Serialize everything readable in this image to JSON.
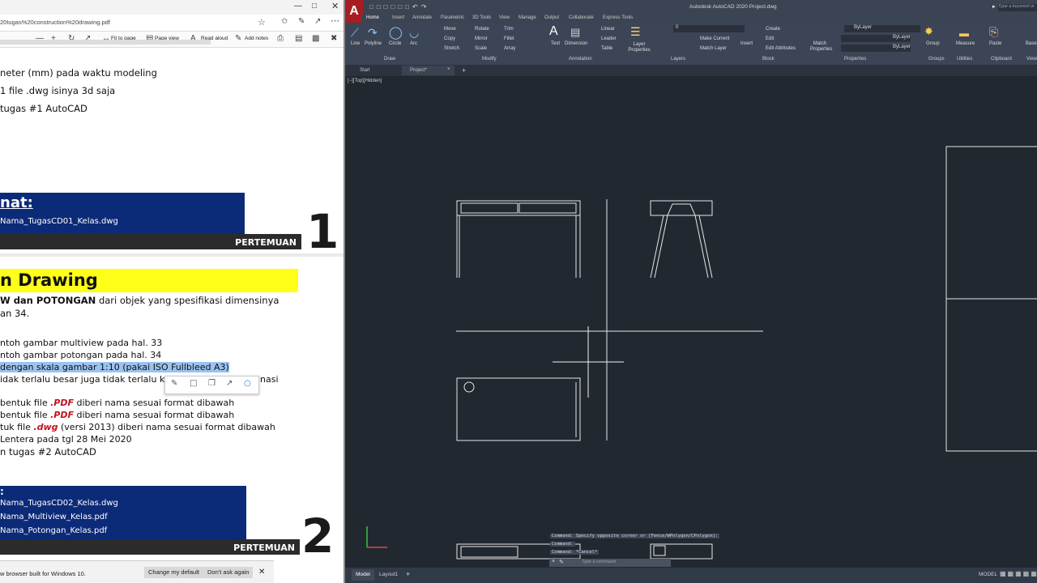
{
  "browser": {
    "url": "20tugas%20construction%20drawing.pdf",
    "toolbar": {
      "fit_to_page": "Fit to page",
      "page_view": "Page view",
      "read_aloud": "Read aloud",
      "add_notes": "Add notes"
    },
    "pdf": {
      "lines_top": [
        "neter (mm) pada waktu modeling",
        "1 file .dwg isinya 3d saja",
        "tugas #1 AutoCAD"
      ],
      "section1": {
        "heading": "nat:",
        "file_name": "Nama_TugasCD01_Kelas.dwg",
        "label": "PERTEMUAN",
        "number": "1"
      },
      "section2": {
        "heading": "n Drawing",
        "intro_bold": "W dan POTONGAN",
        "intro_rest": " dari objek yang spesifikasi dimensinya",
        "intro_line2": "an 34.",
        "items": [
          "ntoh gambar multiview pada hal. 33",
          "ntoh gambar potongan pada hal. 34",
          "dengan skala gambar 1:10 (pakai ISO Fullbleed A3)",
          "idak terlalu besar juga tidak terlalu kecil",
          "inasi"
        ],
        "pdf_line1_a": "bentuk file ",
        "pdf_line1_ext": ".PDF",
        "pdf_line1_b": " diberi nama sesuai format dibawah",
        "pdf_line2_a": "bentuk file ",
        "pdf_line2_ext": ".PDF",
        "pdf_line2_b": " diberi nama sesuai format dibawah",
        "dwg_line_a": "tuk file ",
        "dwg_line_ext": ".dwg",
        "dwg_line_b": " (versi 2013) diberi nama sesuai format dibawah",
        "deadline": "Lentera pada tgl 28 Mei 2020",
        "task": "n tugas #2 AutoCAD",
        "box_heading": ":",
        "files": [
          "Nama_TugasCD02_Kelas.dwg",
          "Nama_Multiview_Kelas.pdf",
          "Nama_Potongan_Kelas.pdf"
        ],
        "label": "PERTEMUAN",
        "number": "2"
      }
    },
    "notification": {
      "text": "w browser built for Windows 10.",
      "change_default": "Change my default",
      "dont_ask": "Don't ask again"
    }
  },
  "acad": {
    "app_letter": "A",
    "title": "Autodesk AutoCAD 2020   Project.dwg",
    "search_placeholder": "Type a keyword or",
    "tabs": [
      "Home",
      "Insert",
      "Annotate",
      "Parametric",
      "3D Tools",
      "View",
      "Manage",
      "Output",
      "Collaborate",
      "Express Tools"
    ],
    "ribbon": {
      "draw_tools": [
        "Line",
        "Polyline",
        "Circle",
        "Arc"
      ],
      "modify_tools": [
        "Move",
        "Copy",
        "Stretch",
        "Rotate",
        "Mirror",
        "Scale",
        "Trim",
        "Fillet",
        "Array"
      ],
      "annotation_tools": [
        "Text",
        "Dimension",
        "Linear",
        "Leader",
        "Table"
      ],
      "layer_tools": [
        "Layer Properties",
        "Make Current",
        "Match Layer"
      ],
      "layer_value": "0",
      "block_tools": [
        "Insert",
        "Create",
        "Edit",
        "Edit Attributes"
      ],
      "match_properties": "Match Properties",
      "bylayer": [
        "ByLayer",
        "ByLayer",
        "ByLayer"
      ],
      "group": "Group",
      "measure": "Measure",
      "paste": "Paste",
      "base": "Base",
      "panels": [
        "Draw",
        "Modify",
        "Annotation",
        "Layers",
        "Block",
        "Properties",
        "Groups",
        "Utilities",
        "Clipboard",
        "View"
      ]
    },
    "doc_tabs": [
      "Start",
      "Project*"
    ],
    "viewport_label": "[−][Top][Hidden]",
    "command_history": [
      "Command: Specify opposite corner or [Fence/WPolygon/CPolygon]:",
      "Command:",
      "Command: *Cancel*"
    ],
    "command_prompt": "Type a command",
    "layout_tabs": [
      "Model",
      "Layout1"
    ],
    "status_model": "MODEL"
  }
}
